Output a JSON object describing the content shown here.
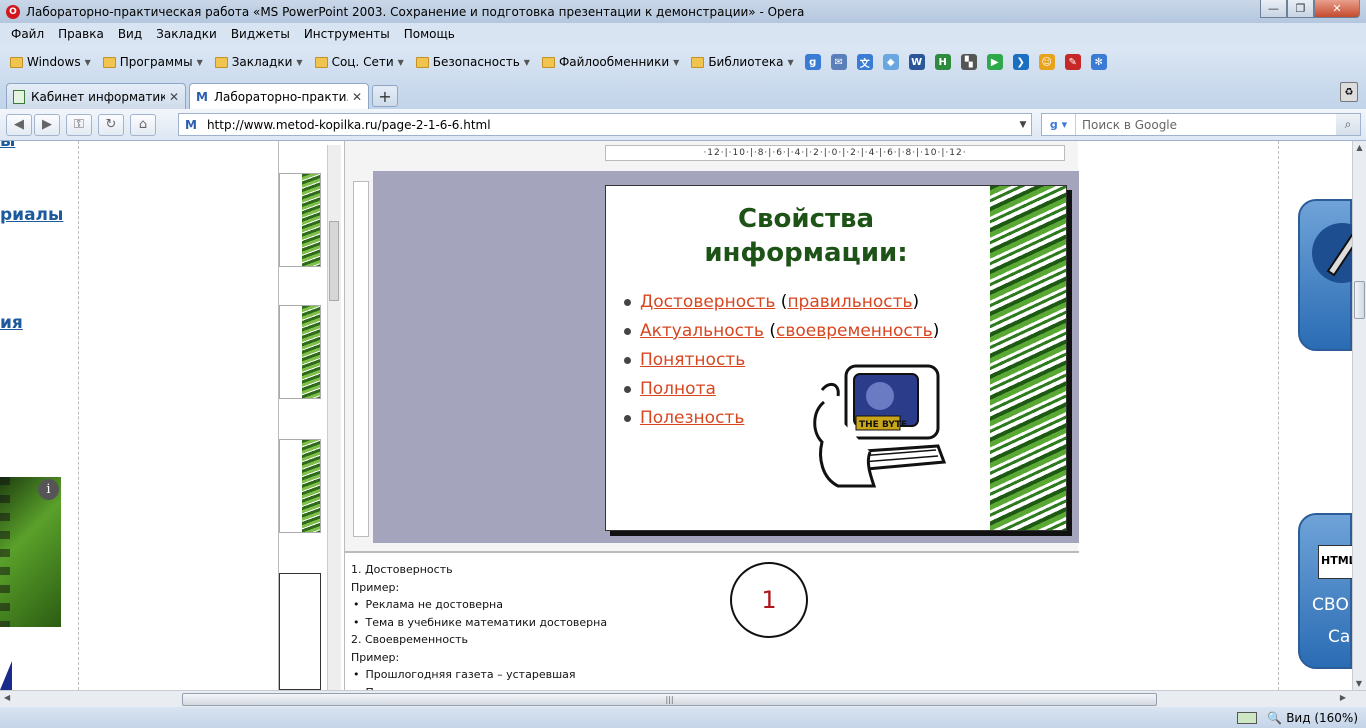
{
  "window": {
    "title": "Лабораторно-практическая работа «MS PowerPoint 2003. Сохранение и подготовка презентации к демонстрации» - Opera"
  },
  "menu": [
    "Файл",
    "Правка",
    "Вид",
    "Закладки",
    "Виджеты",
    "Инструменты",
    "Помощь"
  ],
  "bookmarks": [
    {
      "label": "Windows",
      "has_arrow": true
    },
    {
      "label": "Программы",
      "has_arrow": true
    },
    {
      "label": "Закладки",
      "has_arrow": true
    },
    {
      "label": "Соц. Сети",
      "has_arrow": true
    },
    {
      "label": "Безопасность",
      "has_arrow": true
    },
    {
      "label": "Файлообменники",
      "has_arrow": true
    },
    {
      "label": "Библиотека",
      "has_arrow": true
    }
  ],
  "quick_icons": [
    {
      "name": "google-icon",
      "glyph": "g",
      "color": "#3a7bd5"
    },
    {
      "name": "mail-icon",
      "glyph": "✉",
      "color": "#5b7fb8"
    },
    {
      "name": "translate-icon",
      "glyph": "文",
      "color": "#3a7bd5"
    },
    {
      "name": "drop-icon",
      "glyph": "◆",
      "color": "#6aa6e0"
    },
    {
      "name": "word-icon",
      "glyph": "W",
      "color": "#2b579a"
    },
    {
      "name": "h-icon",
      "glyph": "H",
      "color": "#2e8b3e"
    },
    {
      "name": "flag-icon",
      "glyph": "▚",
      "color": "#555555"
    },
    {
      "name": "play-icon",
      "glyph": "▶",
      "color": "#2ea84a"
    },
    {
      "name": "arrow-icon",
      "glyph": "❯",
      "color": "#1a6fc2"
    },
    {
      "name": "smile-icon",
      "glyph": "☺",
      "color": "#e8a21c"
    },
    {
      "name": "pen-icon",
      "glyph": "✎",
      "color": "#c62828"
    },
    {
      "name": "flower-icon",
      "glyph": "✻",
      "color": "#3a7bd5"
    }
  ],
  "tabs": [
    {
      "label": "Кабинет информатик...",
      "active": false
    },
    {
      "label": "Лабораторно-практи...",
      "active": true
    }
  ],
  "address": {
    "url": "http://www.metod-kopilka.ru/page-2-1-6-6.html"
  },
  "search": {
    "placeholder": "Поиск в Google"
  },
  "left_links": [
    "риалы",
    "ия"
  ],
  "slide": {
    "title_line1": "Свойства",
    "title_line2": "информации:",
    "items": [
      {
        "main": "Достоверность",
        "paren": "правильность"
      },
      {
        "main": "Актуальность",
        "paren": "своевременность"
      },
      {
        "main": "Понятность",
        "paren": ""
      },
      {
        "main": "Полнота",
        "paren": ""
      },
      {
        "main": "Полезность",
        "paren": ""
      }
    ],
    "computer_label": "THE BYTE"
  },
  "ruler": {
    "ticks": "·12·|·10·|·8·|·6·|·4·|·2·|·0·|·2·|·4·|·6·|·8·|·10·|·12·"
  },
  "notes": {
    "lines": [
      {
        "text": "1. Достоверность",
        "bullet": false
      },
      {
        "text": "Пример:",
        "bullet": false
      },
      {
        "text": "Реклама не достоверна",
        "bullet": true
      },
      {
        "text": "Тема в учебнике математики достоверна",
        "bullet": true
      },
      {
        "text": "2. Своевременность",
        "bullet": false
      },
      {
        "text": "Пример:",
        "bullet": false
      },
      {
        "text": "Прошлогодняя газета – устаревшая",
        "bullet": true
      },
      {
        "text": "Последние новости – актуально",
        "bullet": true
      }
    ],
    "circle_number": "1"
  },
  "right_ads": {
    "html_label": "HTML",
    "text1": "СВО",
    "text2": "Са"
  },
  "status": {
    "zoom": "Вид (160%)"
  }
}
